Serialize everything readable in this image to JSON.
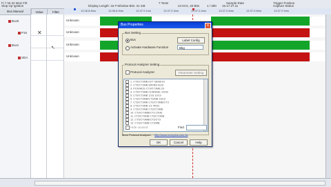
{
  "toolbar": {
    "t1": "Fi 7 Nt 32 MHz Filt",
    "t2": "Stop-Up Ignition",
    "t3": "Display Length: 16 # Window Bits: 31 mB",
    "t4": "7 Tests",
    "t5": "1 / 300",
    "t6": "Sample Rate",
    "t7": "15.17.27.xx",
    "t8": "24 KHz, 40 Bits",
    "t9": "Trigger Position",
    "t10": "Capture Status"
  },
  "left_panel": {
    "header": "Bus Manual",
    "signals": [
      "Bus0",
      "P16",
      "Bus1",
      "P16",
      "SDA"
    ]
  },
  "columns": {
    "value": "Value",
    "filter": "Filter"
  },
  "ruler": {
    "ticks": [
      "13.36.8.8ms",
      "13.36.8.9ms",
      "13.37.0.1ms",
      "13.37.0.3ms",
      "13.37.0.4ms",
      "13.37.0.6ms",
      "13.37.0.8ms",
      "13.37.0.9ms"
    ]
  },
  "waves": {
    "lane_label": "Unknown",
    "colors": {
      "green": "#13a52a",
      "red": "#c41212",
      "idle": "#ffffff"
    }
  },
  "dialog": {
    "title": "Bus Properties",
    "close": "x",
    "bus_setting": "Bus Setting",
    "radio_bus": "Bus",
    "radio_auto": "Activate Hardware Function",
    "btn_list": "Label Config",
    "combo_value": "Bkg",
    "protocol_group": "Protocol Analyzer Setting",
    "chk_protocol": "Protocol Analyzer",
    "btn_protocol_setting": "Parameter Setting",
    "list_items": [
      "1. CT3/CT3MB EXT 08/08/1S",
      "2. CT3/CT3MB WR/RD BUS",
      "3. PCM/ADS CT3/CT3MB 29",
      "4. CT3/CT3MB CHANNEL 09/32",
      "5. CT3/CT3MB 1/2S 10/19",
      "6. CT3/CT3MB/CT3/MB 15/19",
      "7. CT3/CT3MB CT3/CT3MB/CT3",
      "8. CT3/CT3MB 1/2 45/32",
      "9. CT3/CT3MB CT3/CT3MB",
      "10. CT3/CT3MB/CT3 15/36",
      "11. CT3/CT3MB CT3/CT3MB",
      "12. CT3/CT3MB/CT3/CT3",
      "13. CT3/CT3MB CT3/MB"
    ],
    "chk_hide": "Hide unused",
    "find_label": "Find",
    "more_info": "More Protocol Analyzer:",
    "url": "http://www.zeroplus.com.tw",
    "ok": "OK",
    "cancel": "Cancel",
    "help": "Help"
  }
}
